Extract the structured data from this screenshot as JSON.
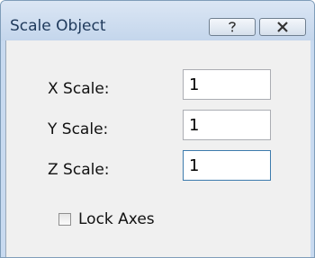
{
  "window": {
    "title": "Scale Object",
    "help_icon": "question-mark-icon",
    "close_icon": "close-x-icon"
  },
  "form": {
    "x_label": "X Scale:",
    "x_value": "1",
    "y_label": "Y Scale:",
    "y_value": "1",
    "z_label": "Z Scale:",
    "z_value": "1",
    "lock_axes_label": "Lock Axes",
    "lock_axes_checked": false
  },
  "colors": {
    "title_bar": "#c4d6ec",
    "title_text": "#1e395b",
    "dialog_bg": "#f0f0f0"
  }
}
